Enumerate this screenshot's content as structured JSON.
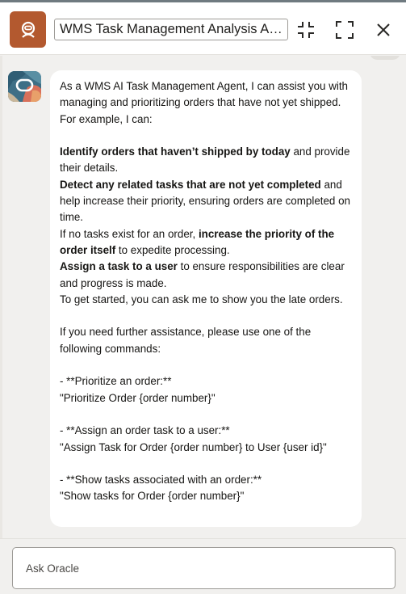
{
  "header": {
    "title": "WMS Task Management Analysis Agent",
    "app_icon": "robot-icon",
    "buttons": [
      {
        "name": "collapse",
        "icon": "collapse-icon"
      },
      {
        "name": "expand",
        "icon": "expand-icon"
      },
      {
        "name": "close",
        "icon": "close-icon"
      }
    ]
  },
  "message": {
    "avatar_icon": "oracle-agent-icon",
    "intro": "As a WMS AI Task Management Agent, I can assist you with managing and prioritizing orders that have not yet shipped. For example, I can:",
    "item1_bold": "Identify orders that haven’t shipped by today",
    "item1_rest": " and provide their details.",
    "item2_bold": "Detect any related tasks that are not yet completed",
    "item2_rest": " and help increase their priority, ensuring orders are completed on time.",
    "item3_pre": "If no tasks exist for an order, ",
    "item3_bold": "increase the priority of the order itself",
    "item3_rest": " to expedite processing.",
    "item4_bold": "Assign a task to a user",
    "item4_rest": " to ensure responsibilities are clear and progress is made.",
    "item5": "To get started, you can ask me to show you the late orders.",
    "help": "If you need further assistance, please use one of the following commands:",
    "cmd1_title": "- **Prioritize an order:**",
    "cmd1_example": "\"Prioritize Order {order number}\"",
    "cmd2_title": "- **Assign an order task to a user:**",
    "cmd2_example": "\"Assign Task for Order {order number} to User {user id}\"",
    "cmd3_title": "- **Show tasks associated with an order:**",
    "cmd3_example": "\"Show tasks for Order {order number}\""
  },
  "input": {
    "placeholder": "Ask Oracle",
    "value": ""
  },
  "colors": {
    "brand": "#b3592f",
    "background": "#f1f0ee",
    "bubble": "#ffffff"
  }
}
